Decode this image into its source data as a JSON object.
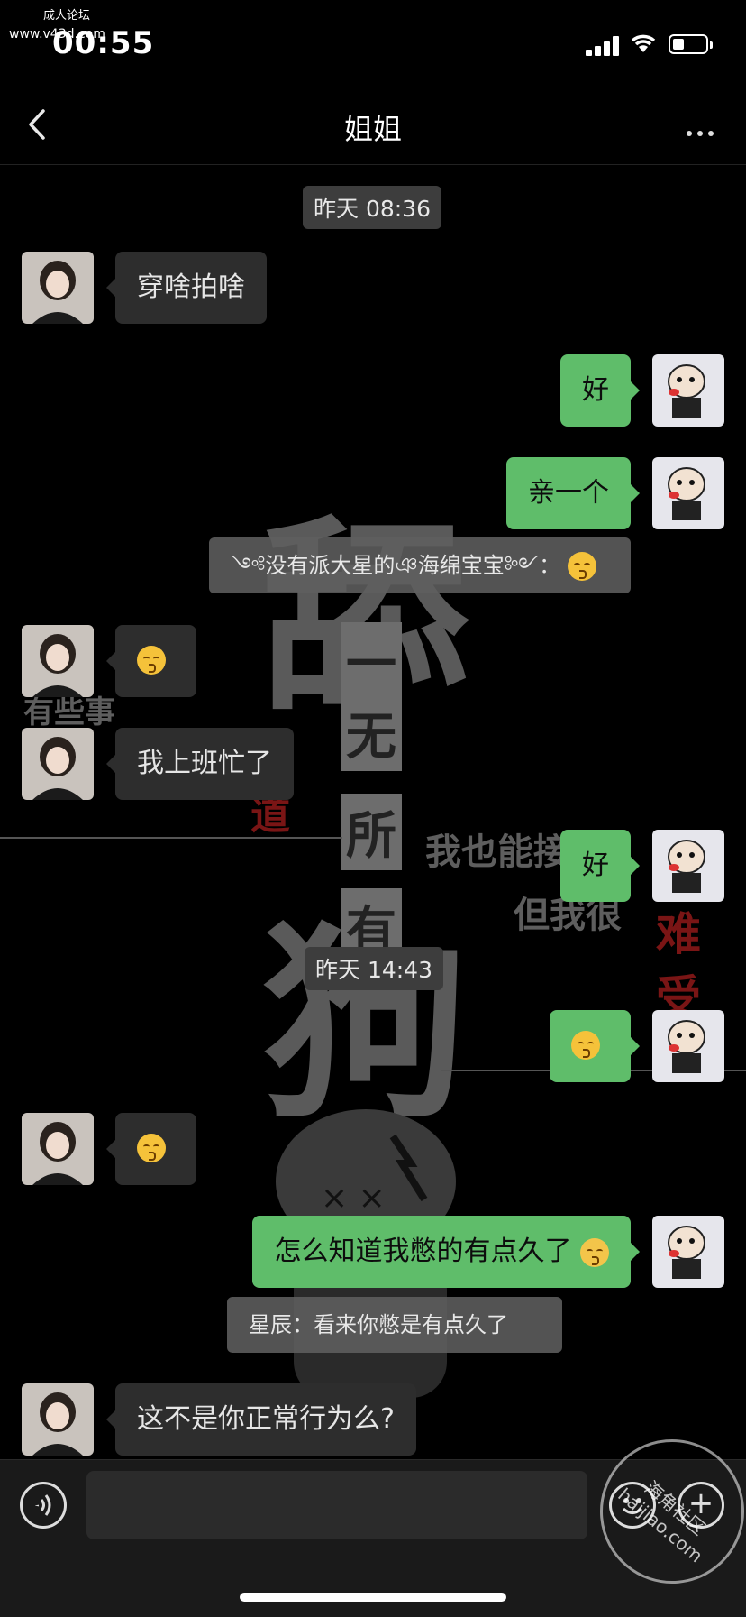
{
  "status_bar": {
    "watermark_top": "成人论坛",
    "watermark_url": "www.v43d.com",
    "time": "00:55"
  },
  "nav": {
    "title": "姐姐"
  },
  "background_text": {
    "big1": "舔",
    "big2": "狗",
    "col1": "一",
    "col2": "无",
    "col3": "所",
    "col4": "有",
    "left": "有些事",
    "right1": "我也能接受",
    "right2": "但我很",
    "red1": "道",
    "red2": "难",
    "red3": "受"
  },
  "chat": {
    "time_1": "昨天 08:36",
    "time_2": "昨天 14:43",
    "messages": [
      {
        "side": "left",
        "text": "穿啥拍啥"
      },
      {
        "side": "right",
        "text": "好"
      },
      {
        "side": "right",
        "text": "亲一个"
      },
      {
        "side": "quote",
        "text": "༺没有派大星的ঞ海绵宝宝༻："
      },
      {
        "side": "left",
        "text": ""
      },
      {
        "side": "left",
        "text": "我上班忙了"
      },
      {
        "side": "right",
        "text": "好"
      },
      {
        "side": "right",
        "text": ""
      },
      {
        "side": "left",
        "text": ""
      },
      {
        "side": "right",
        "text": "怎么知道我憋的有点久了"
      },
      {
        "side": "quote",
        "text": "星辰：看来你憋是有点久了"
      },
      {
        "side": "left",
        "text": "这不是你正常行为么?"
      }
    ]
  },
  "input_bar": {
    "plus": "+"
  },
  "stamp": {
    "line1": "海角社区",
    "line2": "haijiao.com"
  },
  "icons": {
    "back": "chevron-left-icon",
    "more": "more-dots-icon",
    "voice": "voice-icon",
    "emoji": "emoji-icon",
    "plus": "plus-icon"
  },
  "colors": {
    "sent_bubble": "#5fbd6a",
    "received_bubble": "#2d2d2d",
    "background": "#000000"
  }
}
